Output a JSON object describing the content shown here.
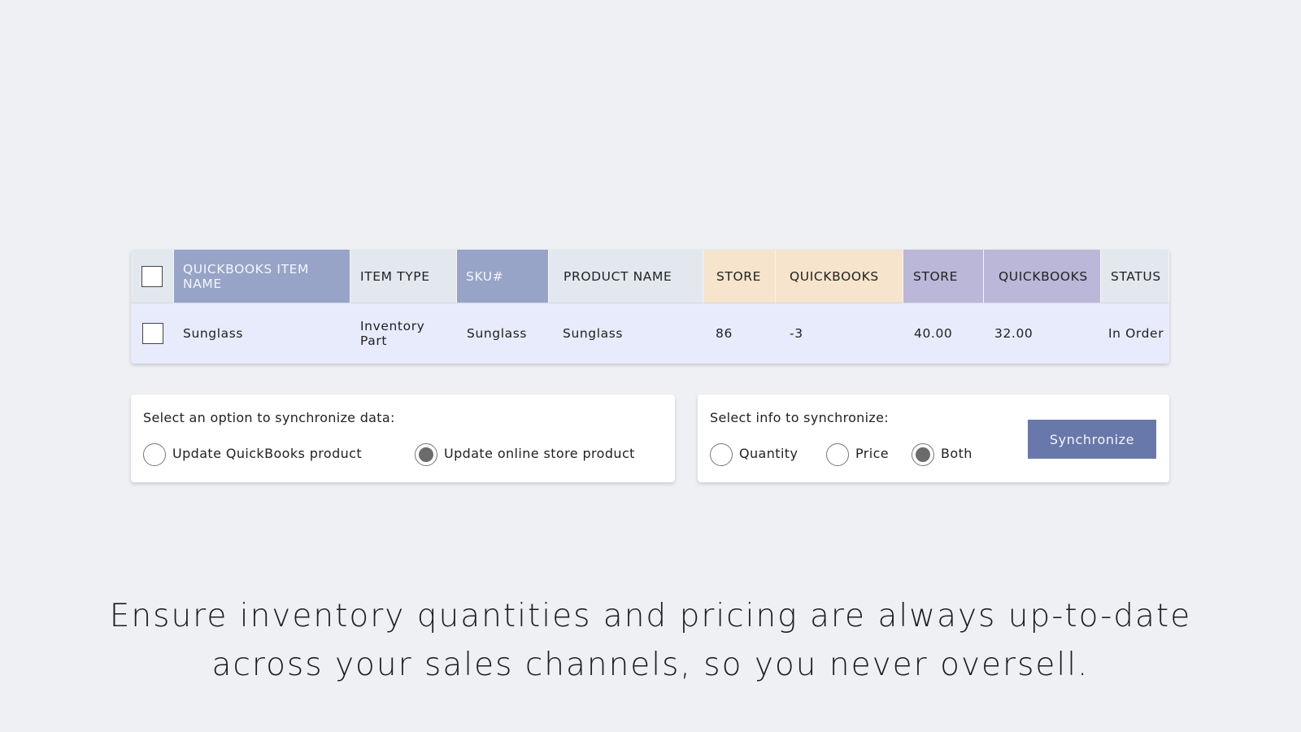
{
  "table": {
    "headers": [
      {
        "label": "QUICKBOOKS ITEM NAME",
        "group": "blue"
      },
      {
        "label": "ITEM TYPE",
        "group": "plain"
      },
      {
        "label": "SKU#",
        "group": "blue"
      },
      {
        "label": "PRODUCT NAME",
        "group": "plain"
      },
      {
        "label": "STORE",
        "group": "quantity"
      },
      {
        "label": "QUICKBOOKS",
        "group": "quantity"
      },
      {
        "label": "STORE",
        "group": "price"
      },
      {
        "label": "QUICKBOOKS",
        "group": "price"
      },
      {
        "label": "STATUS",
        "group": "plain"
      }
    ],
    "rows": [
      {
        "checked": false,
        "quickbooks_item_name": "Sunglass",
        "item_type": "Inventory Part",
        "sku": "Sunglass",
        "product_name": "Sunglass",
        "store_quantity": "86",
        "quickbooks_quantity": "-3",
        "store_price": "40.00",
        "quickbooks_price": "32.00",
        "status": "In Order"
      }
    ],
    "colors": {
      "blue_header": "#97a4c8",
      "quantity_header": "#f6e5cc",
      "price_header": "#bab7d8",
      "plain_header": "#e3e8ef",
      "row_background": "#e7ebfc"
    }
  },
  "sync_direction": {
    "title": "Select an option to synchronize data:",
    "options": [
      {
        "label": "Update QuickBooks product",
        "selected": false
      },
      {
        "label": "Update online store product",
        "selected": true
      }
    ]
  },
  "sync_info": {
    "title": "Select info to synchronize:",
    "options": [
      {
        "label": "Quantity",
        "selected": false
      },
      {
        "label": "Price",
        "selected": false
      },
      {
        "label": "Both",
        "selected": true
      }
    ],
    "button_label": "Synchronize",
    "button_color": "#6878aa"
  },
  "tagline": "Ensure inventory quantities and pricing are always up-to-date across your sales channels, so you never oversell."
}
